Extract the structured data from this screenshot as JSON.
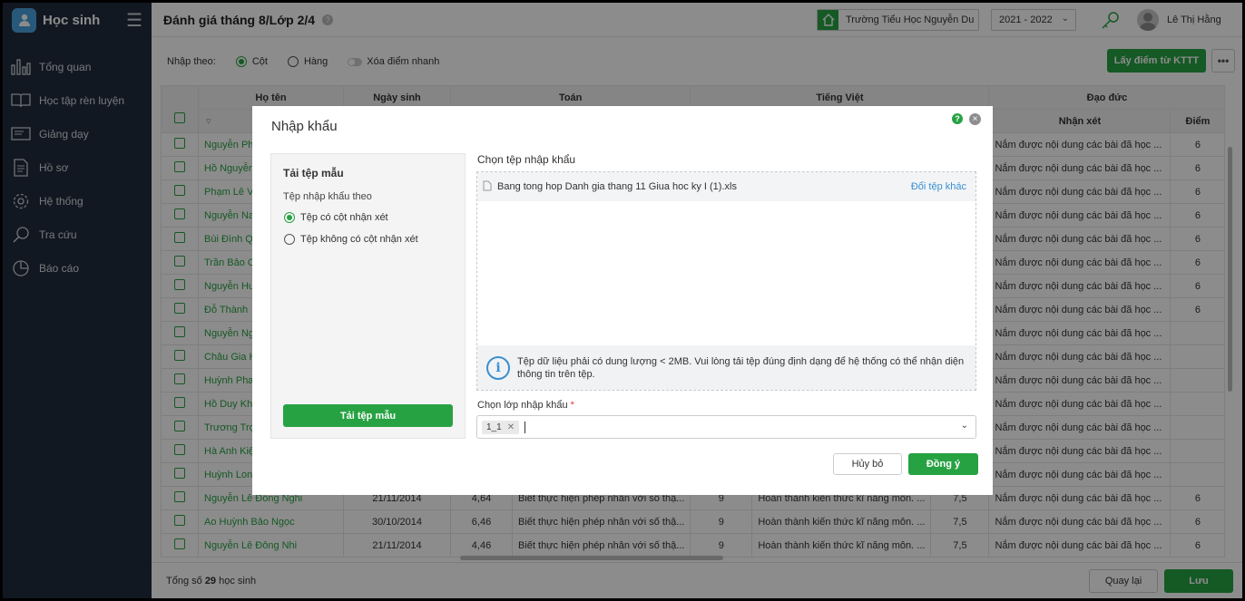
{
  "app": {
    "title": "Học sinh"
  },
  "nav": [
    {
      "label": "Tổng quan",
      "icon": "chart-icon"
    },
    {
      "label": "Học tập rèn luyện",
      "icon": "book-icon"
    },
    {
      "label": "Giảng dạy",
      "icon": "board-icon"
    },
    {
      "label": "Hồ sơ",
      "icon": "document-icon"
    },
    {
      "label": "Hệ thống",
      "icon": "gear-icon"
    },
    {
      "label": "Tra cứu",
      "icon": "search-icon"
    },
    {
      "label": "Báo cáo",
      "icon": "pie-icon"
    }
  ],
  "header": {
    "title": "Đánh giá tháng 8/Lớp 2/4",
    "help": "?",
    "school": "Trường Tiểu Học Nguyễn Du",
    "year": "2021 - 2022",
    "user": "Lê Thị Hằng"
  },
  "toolbar": {
    "input_by": "Nhập theo:",
    "col": "Cột",
    "row": "Hàng",
    "quick_delete": "Xóa điểm nhanh",
    "fetch_btn": "Lấy điểm từ KTTT",
    "more": "•••"
  },
  "grid": {
    "headers": {
      "name": "Họ tên",
      "dob": "Ngày sinh",
      "math": "Toán",
      "viet": "Tiếng Việt",
      "moral": "Đạo đức",
      "comment": "Nhận xét",
      "score": "Điểm"
    },
    "rows": [
      {
        "name": "Nguyễn Ph",
        "dob": "",
        "m": "",
        "mc": "",
        "v": "",
        "vc": "",
        "vs": "",
        "dc": "Nắm được nội dung các bài đã học ...",
        "ds": "6"
      },
      {
        "name": "Hồ Nguyễn",
        "dob": "",
        "m": "",
        "mc": "",
        "v": "",
        "vc": "",
        "vs": "",
        "dc": "Nắm được nội dung các bài đã học ...",
        "ds": "6"
      },
      {
        "name": "Phạm Lê V",
        "dob": "",
        "m": "",
        "mc": "",
        "v": "",
        "vc": "",
        "vs": "",
        "dc": "Nắm được nội dung các bài đã học ...",
        "ds": "6"
      },
      {
        "name": "Nguyễn Na",
        "dob": "",
        "m": "",
        "mc": "",
        "v": "",
        "vc": "",
        "vs": "",
        "dc": "Nắm được nội dung các bài đã học ...",
        "ds": "6"
      },
      {
        "name": "Bùi Đình Q",
        "dob": "",
        "m": "",
        "mc": "",
        "v": "",
        "vc": "",
        "vs": "",
        "dc": "Nắm được nội dung các bài đã học ...",
        "ds": "6"
      },
      {
        "name": "Trần Bảo C",
        "dob": "",
        "m": "",
        "mc": "",
        "v": "",
        "vc": "",
        "vs": "",
        "dc": "Nắm được nội dung các bài đã học ...",
        "ds": "6"
      },
      {
        "name": "Nguyễn Hu",
        "dob": "",
        "m": "",
        "mc": "",
        "v": "",
        "vc": "",
        "vs": "",
        "dc": "Nắm được nội dung các bài đã học ...",
        "ds": "6"
      },
      {
        "name": "Đỗ Thành",
        "dob": "",
        "m": "",
        "mc": "",
        "v": "",
        "vc": "",
        "vs": "",
        "dc": "Nắm được nội dung các bài đã học ...",
        "ds": "6"
      },
      {
        "name": "Nguyễn Ng",
        "dob": "",
        "m": "",
        "mc": "",
        "v": "",
        "vc": "",
        "vs": "",
        "dc": "Nắm được nội dung các bài đã học ...",
        "ds": ""
      },
      {
        "name": "Châu Gia H",
        "dob": "",
        "m": "",
        "mc": "",
        "v": "",
        "vc": "",
        "vs": "",
        "dc": "Nắm được nội dung các bài đã học ...",
        "ds": ""
      },
      {
        "name": "Huỳnh Pha",
        "dob": "",
        "m": "",
        "mc": "",
        "v": "",
        "vc": "",
        "vs": "",
        "dc": "Nắm được nội dung các bài đã học ...",
        "ds": ""
      },
      {
        "name": "Hồ Duy Kh",
        "dob": "",
        "m": "",
        "mc": "",
        "v": "",
        "vc": "",
        "vs": "",
        "dc": "Nắm được nội dung các bài đã học ...",
        "ds": ""
      },
      {
        "name": "Trương Trọ",
        "dob": "",
        "m": "",
        "mc": "",
        "v": "",
        "vc": "",
        "vs": "",
        "dc": "Nắm được nội dung các bài đã học ...",
        "ds": ""
      },
      {
        "name": "Hà Anh Kiệ",
        "dob": "",
        "m": "",
        "mc": "",
        "v": "",
        "vc": "",
        "vs": "",
        "dc": "Nắm được nội dung các bài đã học ...",
        "ds": ""
      },
      {
        "name": "Huỳnh Lon",
        "dob": "",
        "m": "",
        "mc": "",
        "v": "",
        "vc": "",
        "vs": "",
        "dc": "Nắm được nội dung các bài đã học ...",
        "ds": ""
      },
      {
        "name": "Nguyễn Lê Đông Nghi",
        "dob": "21/11/2014",
        "m": "4,64",
        "mc": "Biết thực hiện phép nhân với số thậ...",
        "v": "9",
        "vc": "Hoàn thành kiến thức kĩ năng môn. ...",
        "vs": "7,5",
        "dc": "Nắm được nội dung các bài đã học ...",
        "ds": "6"
      },
      {
        "name": "Ao Huỳnh Bảo Ngọc",
        "dob": "30/10/2014",
        "m": "6,46",
        "mc": "Biết thực hiện phép nhân với số thậ...",
        "v": "9",
        "vc": "Hoàn thành kiến thức kĩ năng môn. ...",
        "vs": "7,5",
        "dc": "Nắm được nội dung các bài đã học ...",
        "ds": "6"
      },
      {
        "name": "Nguyễn Lê Đông Nhi",
        "dob": "21/11/2014",
        "m": "4,46",
        "mc": "Biết thực hiện phép nhân với số thậ...",
        "v": "9",
        "vc": "Hoàn thành kiến thức kĩ năng môn. ...",
        "vs": "7,5",
        "dc": "Nắm được nội dung các bài đã học ...",
        "ds": "6"
      }
    ]
  },
  "footer": {
    "total_prefix": "Tổng số",
    "total_count": "29",
    "total_suffix": "học sinh",
    "back": "Quay lại",
    "save": "Lưu"
  },
  "modal": {
    "title": "Nhập khẩu",
    "help": "?",
    "close": "×",
    "template_title": "Tải tệp mẫu",
    "import_by": "Tệp nhập khẩu theo",
    "opt_with_comment": "Tệp có cột nhận xét",
    "opt_without_comment": "Tệp không có cột nhận xét",
    "download_btn": "Tải tệp mẫu",
    "choose_file_label": "Chọn tệp nhập khẩu",
    "file_name": "Bang tong hop Danh gia thang 11 Giua hoc ky I (1).xls",
    "change_file": "Đổi tệp khác",
    "info_text": "Tệp dữ liệu phải có dung lượng < 2MB. Vui lòng tải tệp đúng định dạng để hệ thống có thể nhận diện thông tin trên tệp.",
    "class_label": "Chọn lớp nhập khẩu",
    "required": "*",
    "class_tag": "1_1",
    "cancel": "Hủy bỏ",
    "ok": "Đồng ý"
  },
  "colors": {
    "accent": "#27a243",
    "sidebar": "#222d3c",
    "link": "#3a8fd1"
  }
}
